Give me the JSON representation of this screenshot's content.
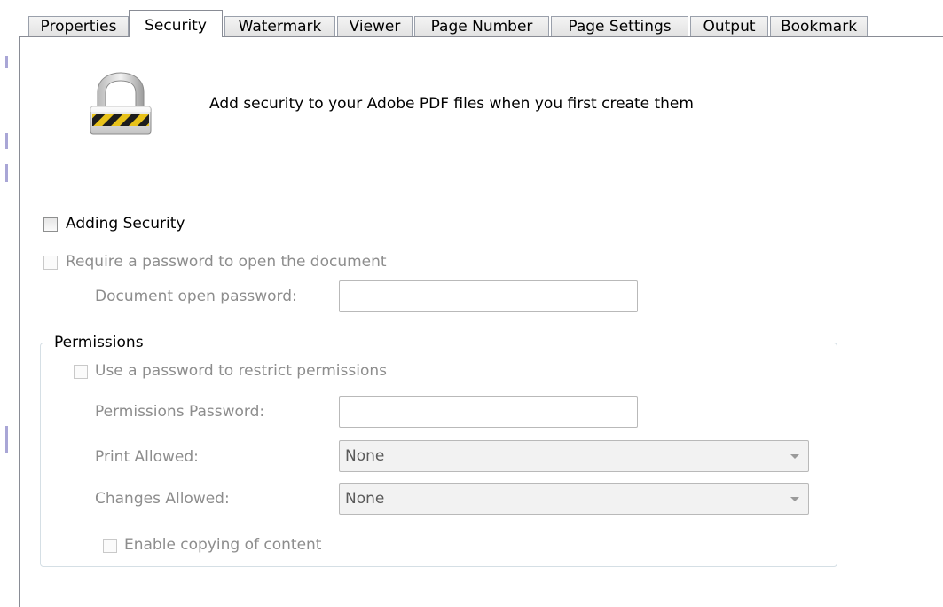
{
  "tabs": [
    {
      "label": "Properties",
      "active": false
    },
    {
      "label": "Security",
      "active": true
    },
    {
      "label": "Watermark",
      "active": false
    },
    {
      "label": "Viewer",
      "active": false
    },
    {
      "label": "Page Number",
      "active": false
    },
    {
      "label": "Page Settings",
      "active": false
    },
    {
      "label": "Output",
      "active": false
    },
    {
      "label": "Bookmark",
      "active": false
    }
  ],
  "header": {
    "icon": "padlock-icon",
    "description": "Add security to your Adobe PDF files when you first create them"
  },
  "security": {
    "adding_security_label": "Adding Security",
    "adding_security_checked": false,
    "require_password_label": "Require a password to open the document",
    "require_password_checked": false,
    "open_password_label": "Document open password:",
    "open_password_value": ""
  },
  "permissions": {
    "group_title": "Permissions",
    "restrict_label": "Use a password to restrict permissions",
    "restrict_checked": false,
    "password_label": "Permissions Password:",
    "password_value": "",
    "print_label": "Print Allowed:",
    "print_value": "None",
    "changes_label": "Changes Allowed:",
    "changes_value": "None",
    "copy_label": "Enable copying of content",
    "copy_checked": false
  },
  "colors": {
    "disabled_text": "#8d8d8d",
    "border": "#898c95",
    "tab_background": "#e2e2e2"
  }
}
